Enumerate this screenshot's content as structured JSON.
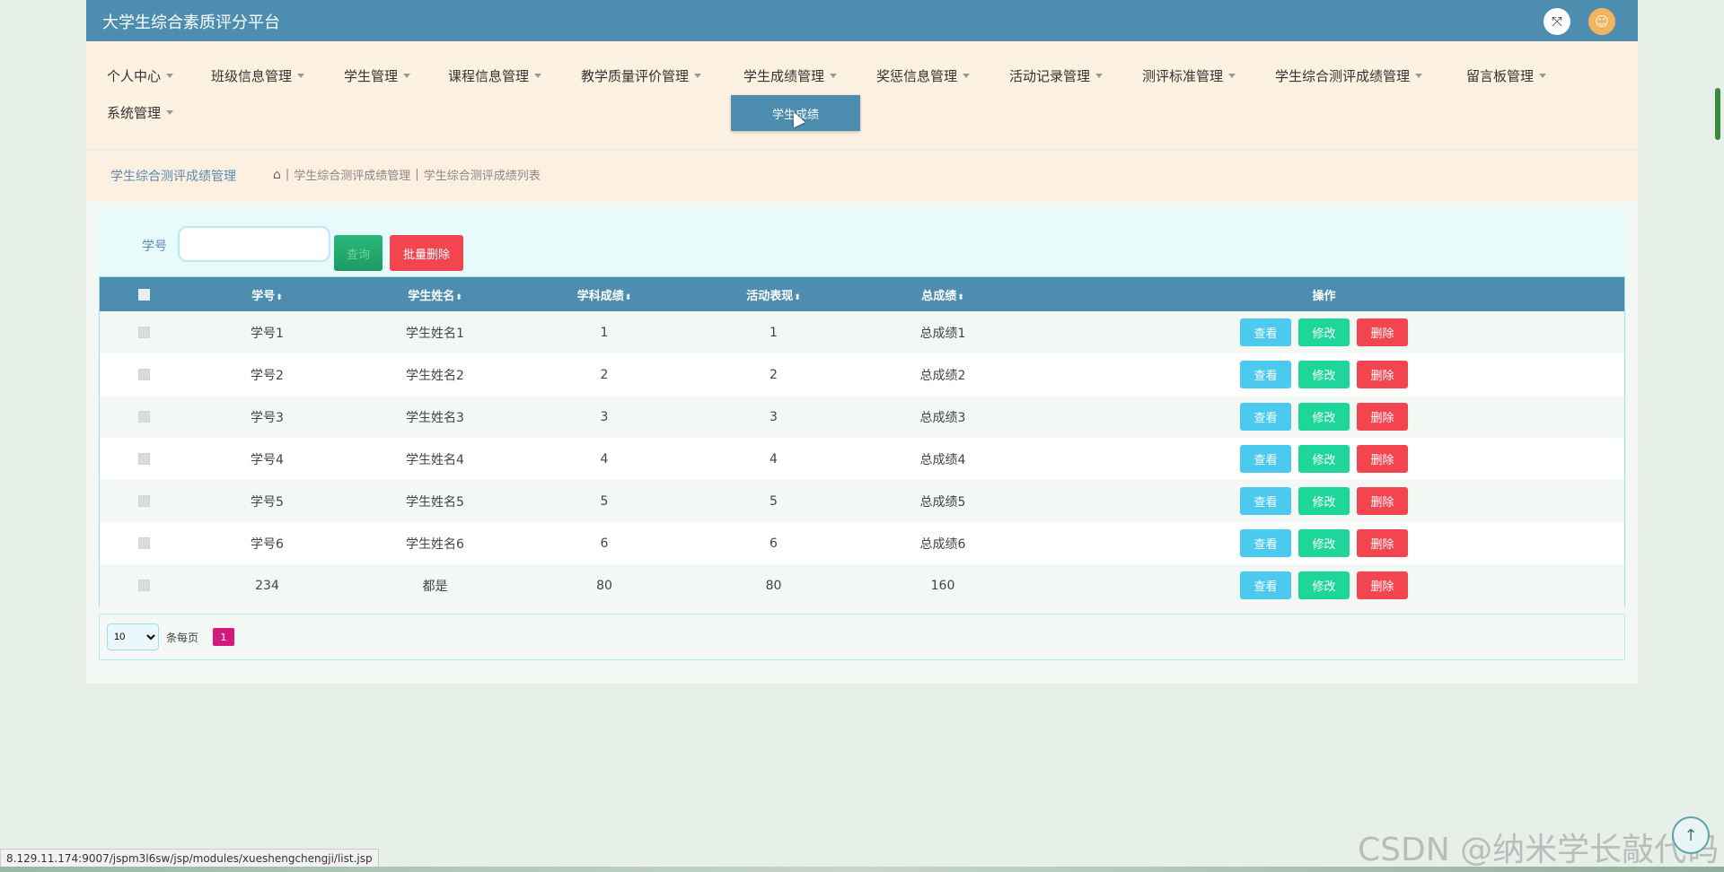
{
  "header": {
    "title": "大学生综合素质评分平台",
    "expand_icon": "expand-icon",
    "user_icon": "user-icon"
  },
  "nav": {
    "items": [
      {
        "label": "个人中心"
      },
      {
        "label": "班级信息管理"
      },
      {
        "label": "学生管理"
      },
      {
        "label": "课程信息管理"
      },
      {
        "label": "教学质量评价管理"
      },
      {
        "label": "学生成绩管理"
      },
      {
        "label": "奖惩信息管理"
      },
      {
        "label": "活动记录管理"
      },
      {
        "label": "测评标准管理"
      },
      {
        "label": "学生综合测评成绩管理"
      },
      {
        "label": "留言板管理"
      },
      {
        "label": "系统管理"
      }
    ],
    "dropdown_item": "学生成绩"
  },
  "breadcrumb": {
    "title": "学生综合测评成绩管理",
    "sep1": "|",
    "level1": "学生综合测评成绩管理",
    "sep2": "|",
    "level2": "学生综合测评成绩列表"
  },
  "search": {
    "label": "学号",
    "value": "",
    "search_button": "查询",
    "batch_delete_button": "批量删除"
  },
  "table": {
    "columns": [
      "学号",
      "学生姓名",
      "学科成绩",
      "活动表现",
      "总成绩",
      "操作"
    ],
    "rows": [
      {
        "student_id": "学号1",
        "name": "学生姓名1",
        "subject": "1",
        "activity": "1",
        "total": "总成绩1"
      },
      {
        "student_id": "学号2",
        "name": "学生姓名2",
        "subject": "2",
        "activity": "2",
        "total": "总成绩2"
      },
      {
        "student_id": "学号3",
        "name": "学生姓名3",
        "subject": "3",
        "activity": "3",
        "total": "总成绩3"
      },
      {
        "student_id": "学号4",
        "name": "学生姓名4",
        "subject": "4",
        "activity": "4",
        "total": "总成绩4"
      },
      {
        "student_id": "学号5",
        "name": "学生姓名5",
        "subject": "5",
        "activity": "5",
        "total": "总成绩5"
      },
      {
        "student_id": "学号6",
        "name": "学生姓名6",
        "subject": "6",
        "activity": "6",
        "total": "总成绩6"
      },
      {
        "student_id": "234",
        "name": "都是",
        "subject": "80",
        "activity": "80",
        "total": "160"
      }
    ],
    "actions": {
      "view": "查看",
      "edit": "修改",
      "delete": "删除"
    }
  },
  "pager": {
    "page_size": "10",
    "per_page_label": "条每页",
    "current_page": "1"
  },
  "status_url": "8.129.11.174:9007/jspm3l6sw/jsp/modules/xueshengchengji/list.jsp",
  "watermark": "CSDN @纳米学长敲代码",
  "colors": {
    "primary": "#4d8db0",
    "view": "#4bc9ee",
    "edit": "#1fd69a",
    "delete": "#f3454f",
    "page_active": "#d4197c"
  }
}
